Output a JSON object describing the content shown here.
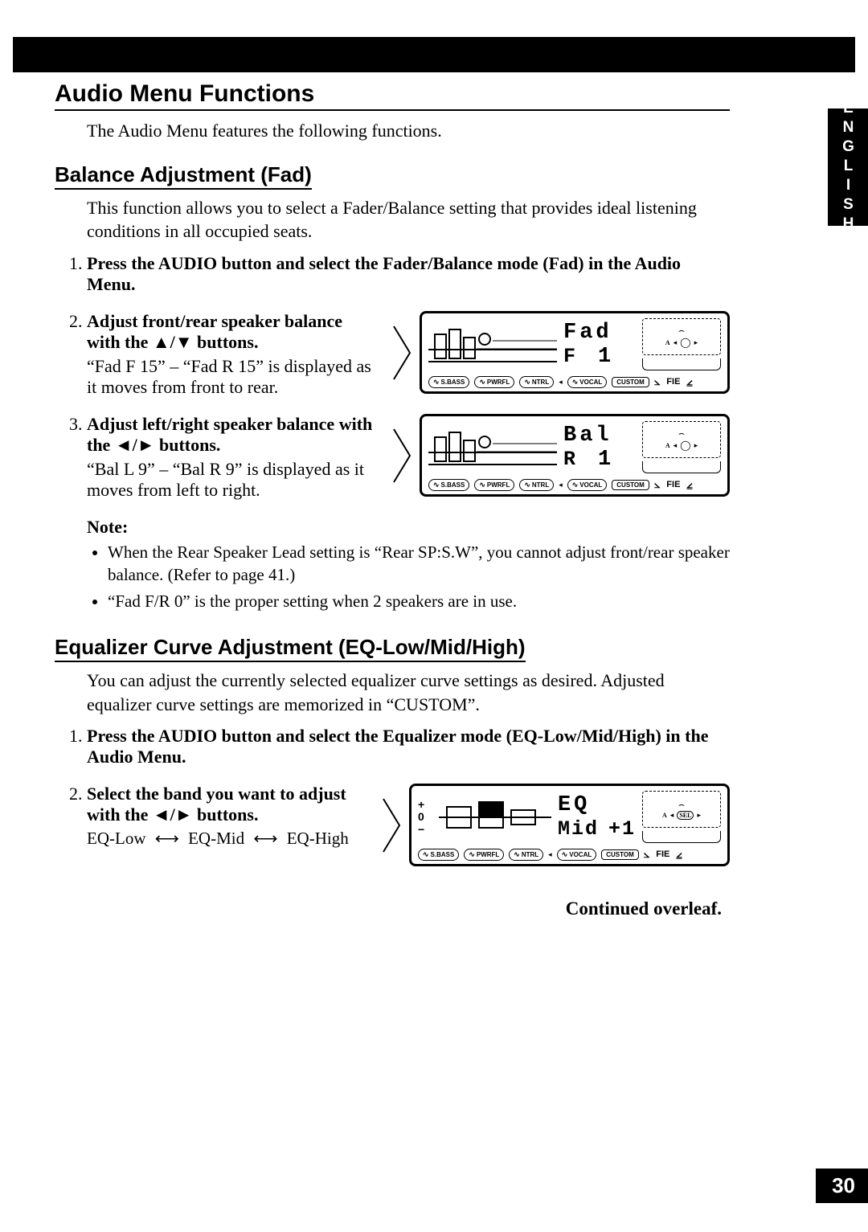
{
  "side_tab": "ENGLISH",
  "page_number": "30",
  "h1": "Audio Menu Functions",
  "intro": "The Audio Menu features the following functions.",
  "balance": {
    "heading": "Balance Adjustment (Fad)",
    "desc": "This function allows you to select a Fader/Balance setting that provides ideal listening conditions in all occupied seats.",
    "step1": "Press the AUDIO button and select the Fader/Balance mode (Fad) in the Audio Menu.",
    "step2_title": "Adjust front/rear speaker balance with the ▲/▼ buttons.",
    "step2_body": "“Fad F 15” – “Fad R 15” is displayed as it moves from front to rear.",
    "step3_title": "Adjust left/right speaker balance with the ◄/► buttons.",
    "step3_body": "“Bal L 9” – “Bal R 9” is displayed as it moves from left to right."
  },
  "fad_display": {
    "title": "Fad",
    "letter": "F",
    "value": "1"
  },
  "bal_display": {
    "title": "Bal",
    "letter": "R",
    "value": "1"
  },
  "eq_display": {
    "title": "EQ",
    "band": "Mid",
    "value": "+1"
  },
  "chips": {
    "sbass": "S.BASS",
    "pwrfl": "PWRFL",
    "ntrl": "NTRL",
    "vocal": "VOCAL",
    "custom": "CUSTOM",
    "fie": "FIE"
  },
  "ctrl": {
    "a_label": "A",
    "sel": "SEL"
  },
  "note": {
    "title": "Note:",
    "b1": "When the Rear Speaker Lead setting is “Rear SP:S.W”, you cannot adjust front/rear speaker balance. (Refer to page 41.)",
    "b2": "“Fad F/R 0” is the proper setting when 2 speakers are in use."
  },
  "eq": {
    "heading": "Equalizer Curve Adjustment (EQ-Low/Mid/High)",
    "desc": "You can adjust the currently selected equalizer curve settings as desired. Adjusted equalizer curve settings are memorized in “CUSTOM”.",
    "step1": "Press the AUDIO button and select the Equalizer mode (EQ-Low/Mid/High) in the Audio Menu.",
    "step2_title": "Select the band you want to adjust with the ◄/► buttons.",
    "nav": {
      "low": "EQ-Low",
      "mid": "EQ-Mid",
      "high": "EQ-High"
    }
  },
  "continued": "Continued overleaf."
}
